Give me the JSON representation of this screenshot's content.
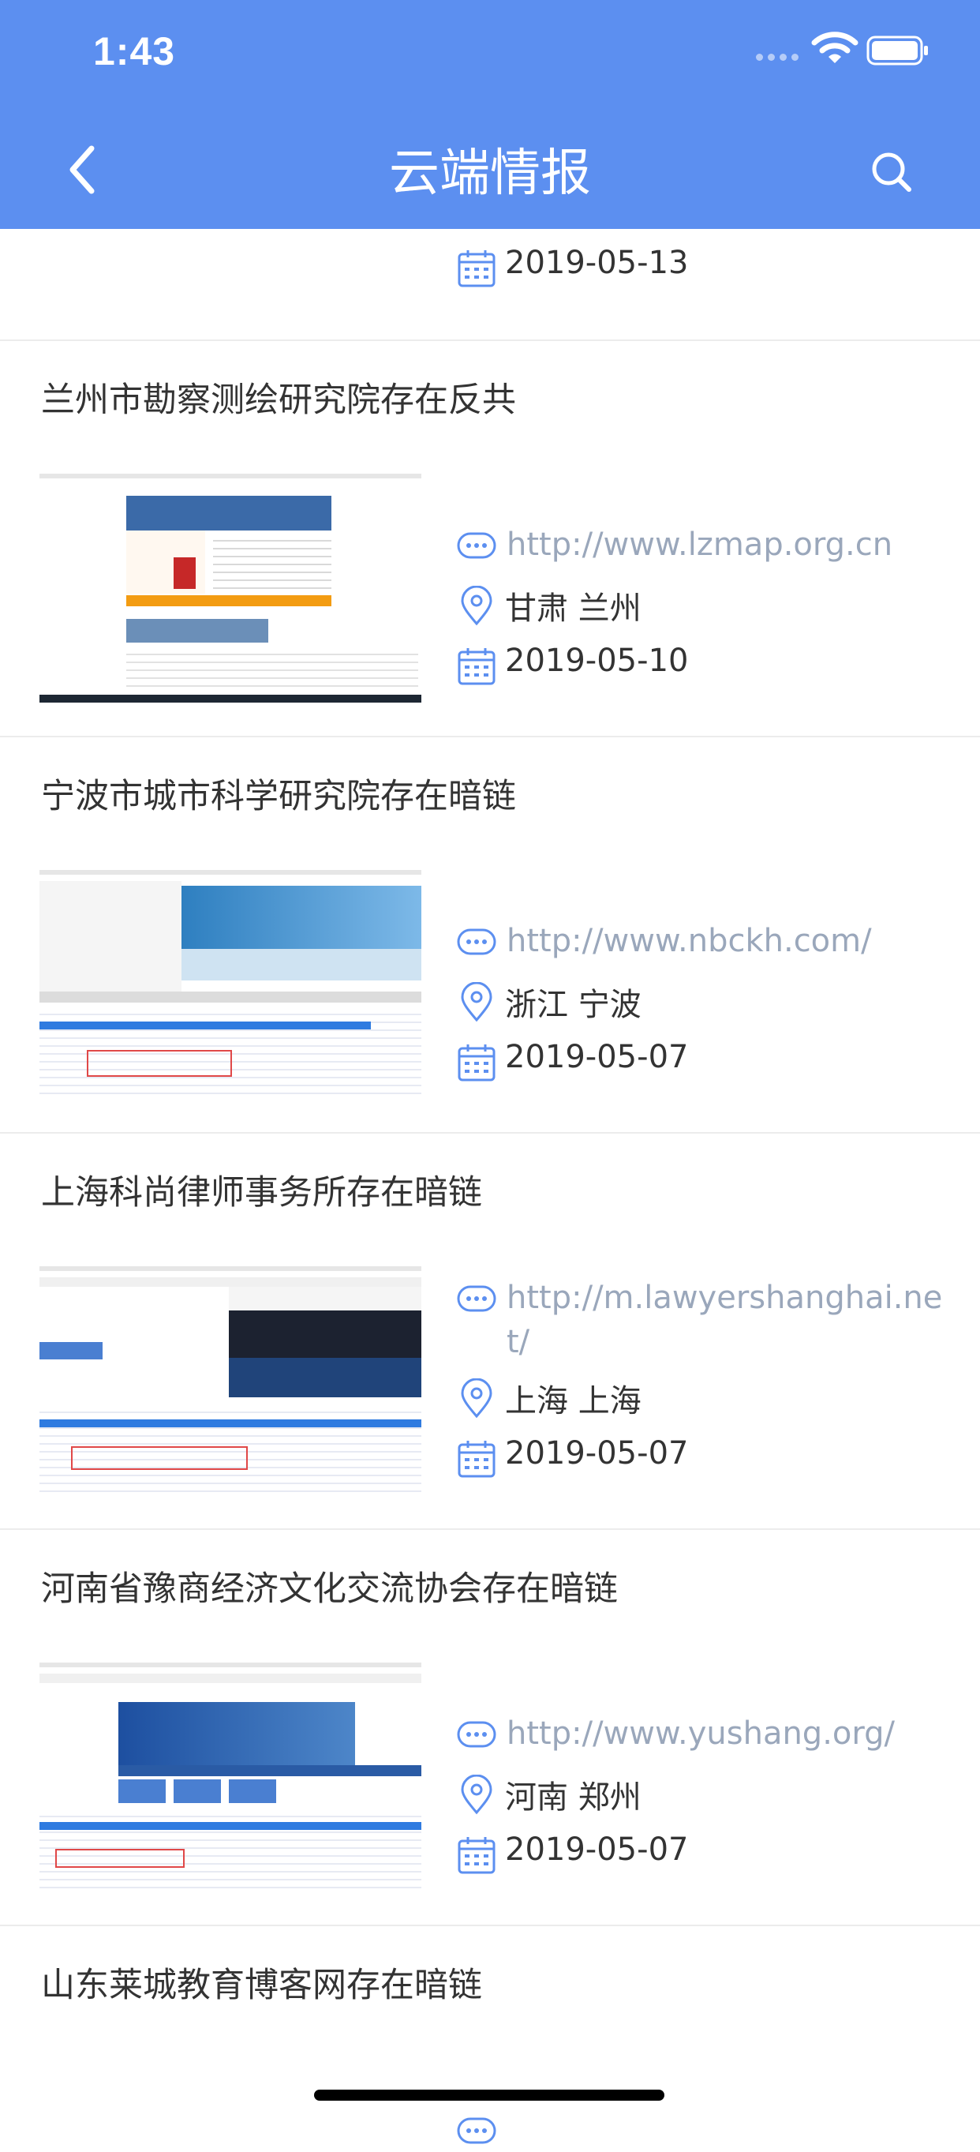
{
  "status_bar": {
    "time": "1:43"
  },
  "nav": {
    "title": "云端情报"
  },
  "partial_top_item": {
    "date": "2019-05-13"
  },
  "items": [
    {
      "title": "兰州市勘察测绘研究院存在反共",
      "url": "http://www.lzmap.org.cn",
      "location": "甘肃 兰州",
      "date": "2019-05-10"
    },
    {
      "title": "宁波市城市科学研究院存在暗链",
      "url": "http://www.nbckh.com/",
      "location": "浙江 宁波",
      "date": "2019-05-07"
    },
    {
      "title": "上海科尚律师事务所存在暗链",
      "url": "http://m.lawyershanghai.net/",
      "location": "上海 上海",
      "date": "2019-05-07"
    },
    {
      "title": "河南省豫商经济文化交流协会存在暗链",
      "url": "http://www.yushang.org/",
      "location": "河南 郑州",
      "date": "2019-05-07"
    },
    {
      "title": "山东莱城教育博客网存在暗链"
    }
  ],
  "colors": {
    "header": "#5c8ff0",
    "icon": "#5c8ff0",
    "url": "#9aa7bb",
    "text": "#333333"
  }
}
